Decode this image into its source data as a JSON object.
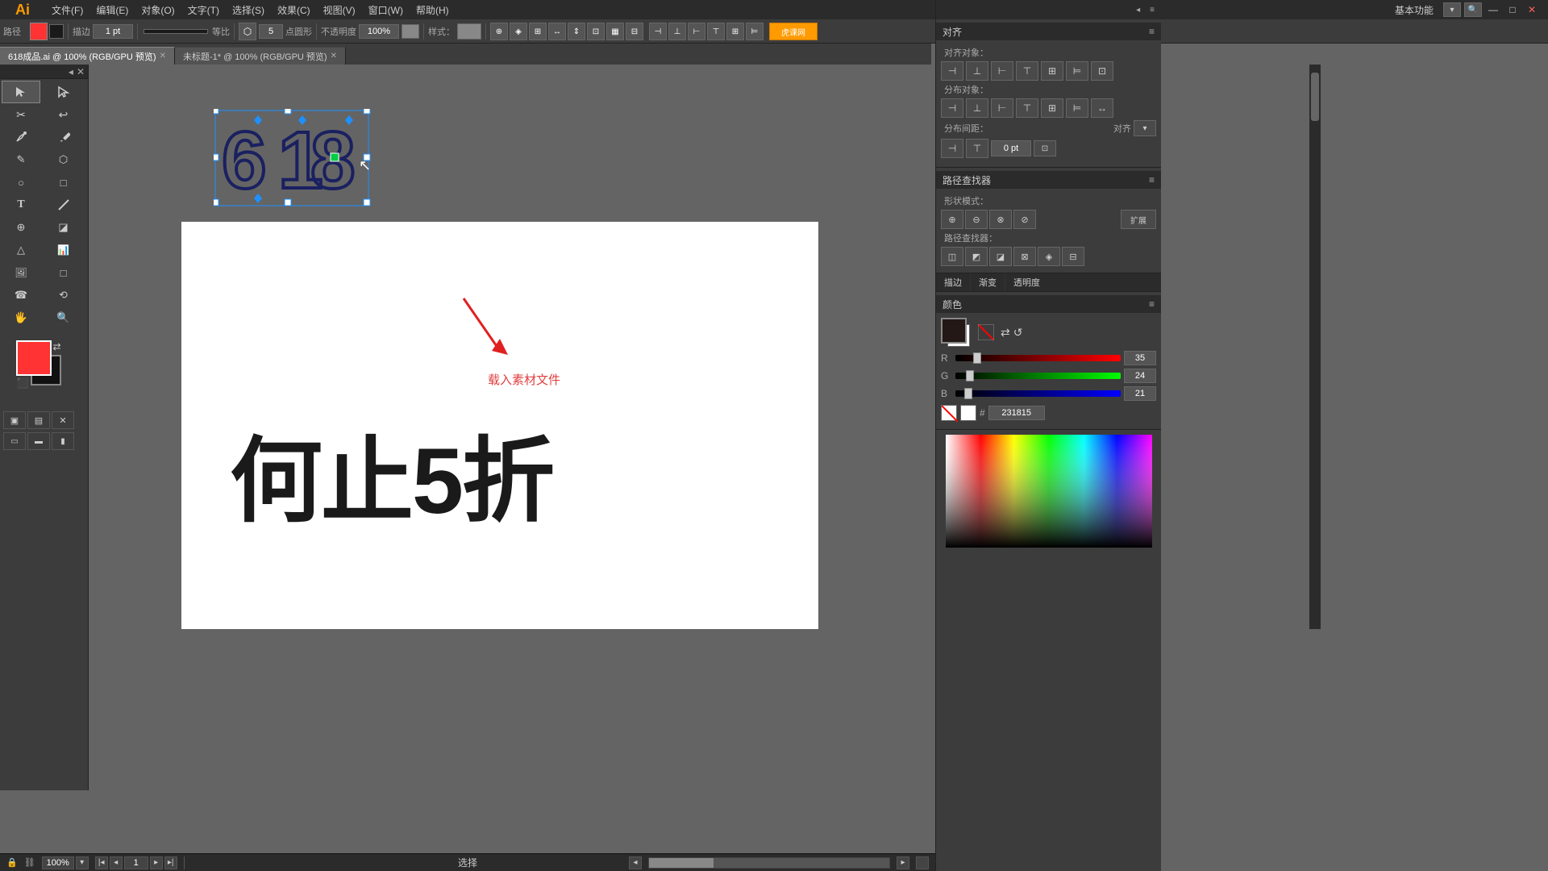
{
  "app": {
    "logo": "Ai",
    "title": "Adobe Illustrator"
  },
  "menubar": {
    "items": [
      "文件(F)",
      "编辑(E)",
      "对象(O)",
      "文字(T)",
      "选择(S)",
      "效果(C)",
      "视图(V)",
      "窗口(W)",
      "帮助(H)"
    ],
    "right_label": "基本功能",
    "window_buttons": [
      "—",
      "□",
      "✕"
    ]
  },
  "toolbar": {
    "path_label": "路径",
    "stroke_label": "描边",
    "stroke_weight": "1 pt",
    "line_style": "等比",
    "point_count": "5",
    "shape_label": "点圆形",
    "opacity_label": "不透明度",
    "opacity_value": "100%",
    "style_label": "样式："
  },
  "tabs": [
    {
      "label": "618成品.ai @ 100% (RGB/GPU 预览)",
      "active": true
    },
    {
      "label": "未标题-1* @ 100% (RGB/GPU 预览)",
      "active": false
    }
  ],
  "tools": [
    "↖",
    "↗",
    "✂",
    "↩",
    "✒",
    "✏",
    "✎",
    "⬡",
    "○",
    "□",
    "⌨",
    "✐",
    "⊕",
    "◪",
    "△",
    "📊",
    "🖼",
    "□",
    "☎",
    "⟲",
    "🖐",
    "🔍"
  ],
  "statusbar": {
    "zoom": "100%",
    "page": "1",
    "status_label": "选择",
    "artboard_label": "选择"
  },
  "annotation": {
    "text": "载入素材文件"
  },
  "main_text": "何止5折",
  "right_panel": {
    "align_title": "对齐",
    "align_object_label": "对齐对象：",
    "distribute_object_label": "分布对象：",
    "distribute_spacing_label": "分布间距：",
    "align_to_label": "对齐",
    "spacing_value": "0 pt",
    "pathfinder_title": "路径查找器",
    "shape_mode_label": "形状模式：",
    "pathfinder_label": "路径查找器：",
    "expand_btn": "扩展",
    "color_title": "颜色",
    "stroke_tab": "描边",
    "gradient_tab": "渐变",
    "opacity_tab": "透明度",
    "r_value": "35",
    "g_value": "24",
    "b_value": "21",
    "hex_value": "231815"
  }
}
